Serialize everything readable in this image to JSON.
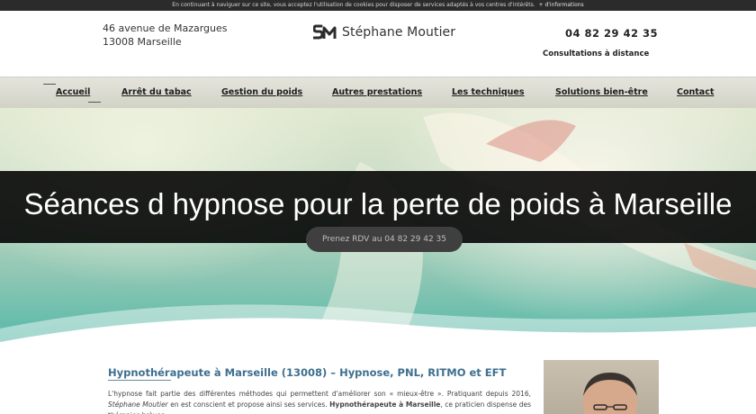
{
  "cookie_bar": {
    "text": "En continuant à naviguer sur ce site, vous acceptez l'utilisation de cookies pour disposer de services adaptés à vos centres d'intérêts.",
    "link": "+ d'informations"
  },
  "header": {
    "address_line1": "46 avenue de Mazargues",
    "address_line2": "13008 Marseille",
    "brand_name": "Stéphane Moutier",
    "phone": "04 82 29 42 35",
    "consultation": "Consultations à distance"
  },
  "nav": {
    "items": [
      {
        "label": "Accueil"
      },
      {
        "label": "Arrêt du tabac"
      },
      {
        "label": "Gestion du poids"
      },
      {
        "label": "Autres prestations"
      },
      {
        "label": "Les techniques"
      },
      {
        "label": "Solutions bien-être"
      },
      {
        "label": "Contact"
      }
    ]
  },
  "hero": {
    "title": "Séances d hypnose pour la perte de poids à Marseille",
    "button_label": "Prenez RDV au 04 82 29 42 35"
  },
  "content": {
    "title": "Hypnothérapeute à Marseille (13008) – Hypnose, PNL, RITMO et EFT",
    "paragraph_part1": "L'hypnose fait partie des différentes méthodes qui permettent d'améliorer son « mieux-être ». Pratiquant depuis 2016, ",
    "paragraph_italic": "Stéphane Moutier",
    "paragraph_part2": " en est conscient et propose ainsi ses services. ",
    "paragraph_bold": "Hypnothérapeute à Marseille",
    "paragraph_part3": ", ce praticien dispense des thérapies brèves"
  },
  "colors": {
    "accent": "#3d6f8f",
    "hero_band": "#000000",
    "nav_background": "#d9dace"
  },
  "icons": {
    "logo": "sm-monogram-logo"
  }
}
